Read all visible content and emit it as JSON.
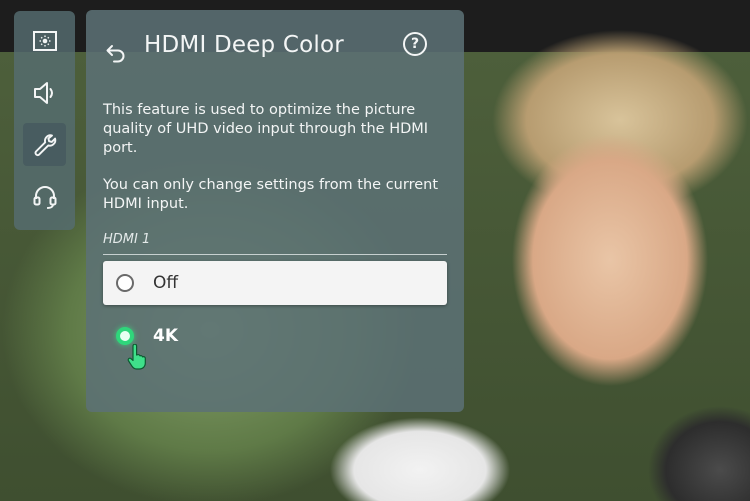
{
  "rail": {
    "items": [
      {
        "icon": "picture-settings-icon",
        "active": false
      },
      {
        "icon": "speaker-icon",
        "active": false
      },
      {
        "icon": "wrench-icon",
        "active": true
      },
      {
        "icon": "headset-icon",
        "active": false
      }
    ]
  },
  "panel": {
    "title": "HDMI Deep Color",
    "back_icon": "back-arrow-icon",
    "help_label": "?",
    "description_1": "This feature is used to optimize the picture quality of UHD video input through the HDMI port.",
    "description_2": "You can only change settings from the current HDMI input.",
    "section_label": "HDMI 1",
    "options": [
      {
        "label": "Off",
        "selected": false,
        "focused": true
      },
      {
        "label": "4K",
        "selected": true,
        "focused": false
      }
    ]
  },
  "colors": {
    "panel_bg": "#5c7176",
    "selected_radio": "#2fd67b",
    "focus_row_bg": "#f4f4f4"
  }
}
